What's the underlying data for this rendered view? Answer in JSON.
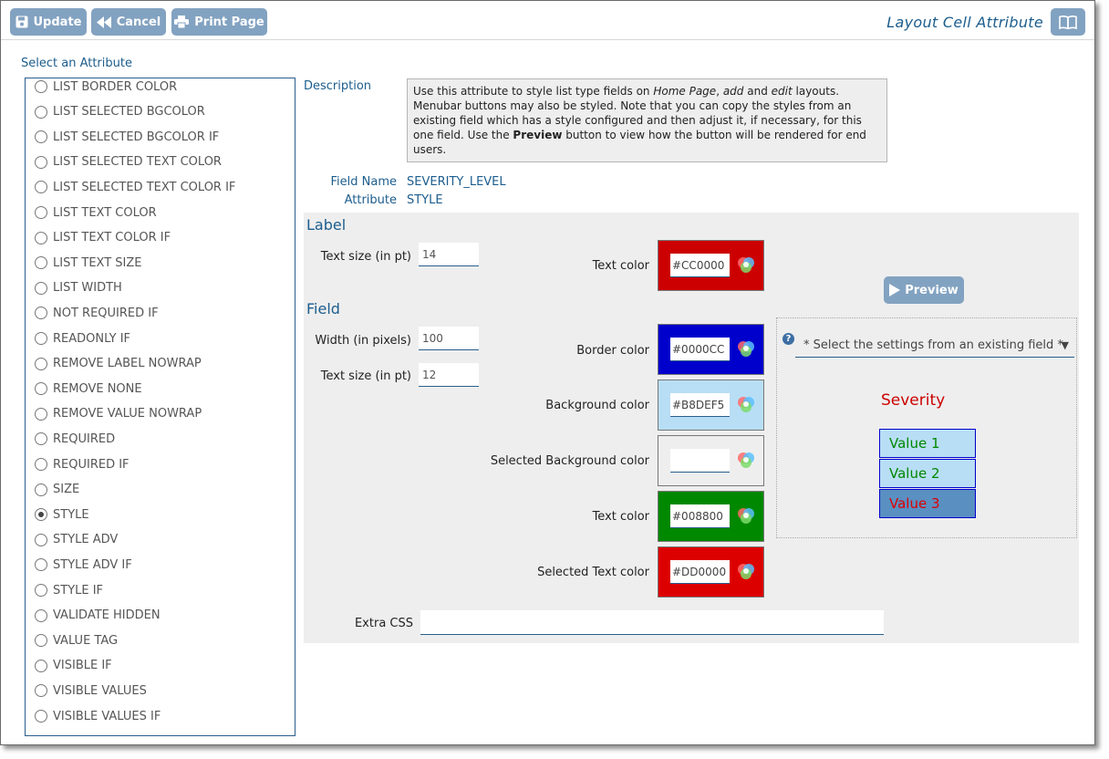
{
  "toolbar": {
    "update_label": "Update",
    "cancel_label": "Cancel",
    "print_label": "Print Page",
    "title": "Layout Cell Attribute"
  },
  "attributes": {
    "heading": "Select an Attribute",
    "items": [
      "LIST BORDER COLOR",
      "LIST SELECTED BGCOLOR",
      "LIST SELECTED BGCOLOR IF",
      "LIST SELECTED TEXT COLOR",
      "LIST SELECTED TEXT COLOR IF",
      "LIST TEXT COLOR",
      "LIST TEXT COLOR IF",
      "LIST TEXT SIZE",
      "LIST WIDTH",
      "NOT REQUIRED IF",
      "READONLY IF",
      "REMOVE LABEL NOWRAP",
      "REMOVE NONE",
      "REMOVE VALUE NOWRAP",
      "REQUIRED",
      "REQUIRED IF",
      "SIZE",
      "STYLE",
      "STYLE ADV",
      "STYLE ADV IF",
      "STYLE IF",
      "VALIDATE HIDDEN",
      "VALUE TAG",
      "VISIBLE IF",
      "VISIBLE VALUES",
      "VISIBLE VALUES IF"
    ],
    "selected": "STYLE"
  },
  "description": {
    "label": "Description",
    "t1": "Use this attribute to style list type fields on ",
    "t2": "Home Page",
    "t3": ", ",
    "t4": "add",
    "t5": " and ",
    "t6": "edit",
    "t7": " layouts. Menubar buttons may also be styled. Note that you can copy the styles from an existing field which has a style configured and then adjust it, if necessary, for this one field. Use the ",
    "t8": "Preview",
    "t9": " button to view how the button will be rendered for end users."
  },
  "meta": {
    "field_name_label": "Field Name",
    "field_name_value": "SEVERITY_LEVEL",
    "attribute_label": "Attribute",
    "attribute_value": "STYLE"
  },
  "label_section": {
    "title": "Label",
    "text_size_label": "Text size (in pt)",
    "text_size_value": "14",
    "text_color_label": "Text color",
    "text_color_value": "#CC0000"
  },
  "field_section": {
    "title": "Field",
    "width_label": "Width (in pixels)",
    "width_value": "100",
    "text_size_label": "Text size (in pt)",
    "text_size_value": "12",
    "border_color_label": "Border color",
    "border_color_value": "#0000CC",
    "background_color_label": "Background color",
    "background_color_value": "#B8DEF5",
    "selected_background_label": "Selected Background color",
    "selected_background_value": "",
    "text_color_label": "Text color",
    "text_color_value": "#008800",
    "selected_text_color_label": "Selected Text color",
    "selected_text_color_value": "#DD0000",
    "extra_css_label": "Extra CSS",
    "extra_css_value": ""
  },
  "preview": {
    "button_label": "Preview",
    "existing_placeholder": "* Select the settings from an existing field *",
    "sample_label": "Severity",
    "options": [
      "Value 1",
      "Value 2",
      "Value 3"
    ]
  },
  "colors": {
    "label_text": "#CC0000",
    "border": "#0000CC",
    "background": "#B8DEF5",
    "selected_background": "#5A8FC2",
    "text": "#008800",
    "selected_text": "#DD0000",
    "selected_text_swatch": "#DD0000",
    "label_swatch": "#CC0000",
    "selected_bg_swatch": "#EEEEEE"
  }
}
